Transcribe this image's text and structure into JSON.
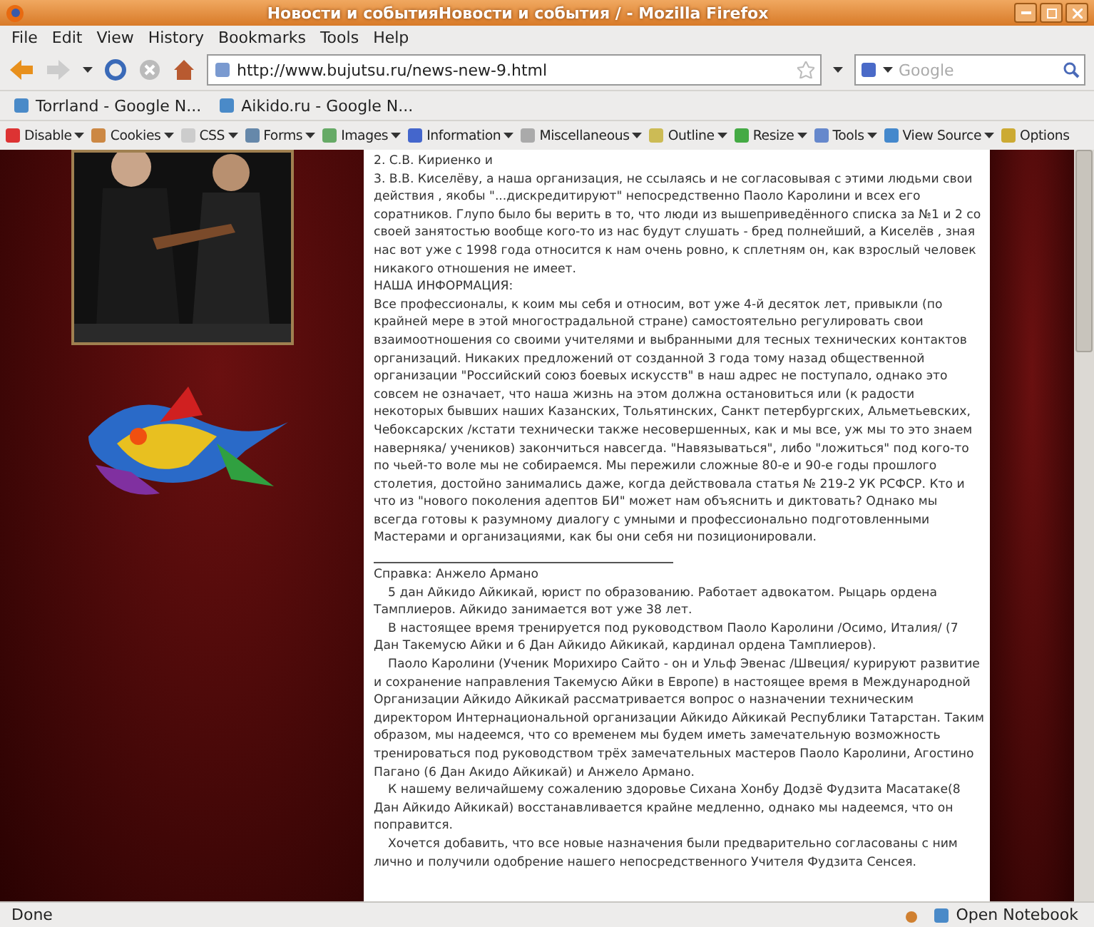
{
  "window": {
    "title": "Новости и событияНовости и события / - Mozilla Firefox"
  },
  "menu": [
    "File",
    "Edit",
    "View",
    "History",
    "Bookmarks",
    "Tools",
    "Help"
  ],
  "address": {
    "value": "http://www.bujutsu.ru/news-new-9.html"
  },
  "search": {
    "placeholder": "Google"
  },
  "bookmarks": [
    "Torrland - Google N...",
    "Aikido.ru - Google N..."
  ],
  "devtools": [
    "Disable",
    "Cookies",
    "CSS",
    "Forms",
    "Images",
    "Information",
    "Miscellaneous",
    "Outline",
    "Resize",
    "Tools",
    "View Source",
    "Options"
  ],
  "article": {
    "paragraphs": [
      {
        "text": "2. С.В. Кириенко и",
        "indent": false
      },
      {
        "text": "3. В.В. Киселёву,    а наша организация, не ссылаясь и не согласовывая с этими людьми свои действия , якобы \"...дискредитируют\"  непосредственно Паоло Каролини и всех его соратников. Глупо было бы верить в то, что люди из вышеприведённого списка за №1 и 2 со своей занятостью  вообще кого-то из нас будут слушать - бред полнейший, а Киселёв , зная нас вот уже с 1998 года относится к нам очень ровно, к сплетням он, как взрослый человек никакого отношения не имеет.",
        "indent": false
      },
      {
        "text": "НАША ИНФОРМАЦИЯ:",
        "indent": false
      },
      {
        "text": "Все профессионалы, к коим мы себя и относим,  вот уже 4-й десяток лет, привыкли (по крайней мере в этой многострадальной стране) самостоятельно регулировать свои взаимоотношения со своими учителями и выбранными для тесных  технических контактов организаций. Никаких предложений от созданной 3 года тому назад общественной организации \"Российский союз боевых искусств\" в наш адрес не поступало, однако это совсем не означает, что наша жизнь на этом должна остановиться или (к радости некоторых бывших наших  Казанских, Тольятинских, Санкт петербургских, Альметьевских, Чебоксарских /кстати технически также несовершенных, как и мы все, уж мы то это знаем наверняка/ учеников) закончиться навсегда. \"Навязываться\", либо \"ложиться\" под кого-то  по чьей-то воле мы не собираемся.  Мы пережили сложные 80-е и 90-е годы прошлого столетия, достойно занимались даже, когда действовала статья № 219-2 УК РСФСР. Кто и что из \"нового поколения адептов БИ\" может нам объяснить и диктовать?   Однако мы всегда готовы к разумному диалогу с умными и профессионально подготовленными  Мастерами и организациями, как бы они себя ни позиционировали.",
        "indent": false
      }
    ],
    "note_paragraphs": [
      {
        "text": "Справка: Анжело Армано",
        "indent": false
      },
      {
        "text": "5 дан Айкидо Айкикай, юрист по образованию. Работает адвокатом. Рыцарь ордена Тамплиеров.  Айкидо занимается вот уже 38 лет.",
        "indent": true
      },
      {
        "text": "В настоящее время тренируется под руководством  Паоло Каролини  /Осимо, Италия/ (7 Дан Такемусю Айки и 6 Дан Айкидо Айкикай, кардинал ордена Тамплиеров).",
        "indent": true
      },
      {
        "text": "Паоло Каролини (Ученик Морихиро Сайто  - он и Ульф Эвенас /Швеция/  курируют развитие и сохранение направления Такемусю Айки в  Европе) в настоящее время  в Международной Организации Айкидо Айкикай рассматривается вопрос о назначении техническим директором Интернациональной организации Айкидо Айкикай Республики Татарстан. Таким образом,  мы надеемся,  что со временем  мы будем иметь замечательную возможность тренироваться под руководством трёх замечательных мастеров Паоло Каролини, Агостино Пагано (6 Дан Акидо Айкикай) и Анжело Армано.",
        "indent": true
      },
      {
        "text": "К нашему величайшему сожалению здоровье Сихана Хонбу Додзё Фудзита Масатаке(8 Дан Айкидо Айкикай) восстанавливается крайне медленно, однако мы надеемся, что он поправится.",
        "indent": true
      },
      {
        "text": "Хочется добавить, что все новые назначения были предварительно согласованы с ним лично и получили одобрение нашего непосредственного Учителя Фудзита Сенсея.",
        "indent": true
      }
    ]
  },
  "status": {
    "text": "Done",
    "notebook": "Open Notebook"
  }
}
